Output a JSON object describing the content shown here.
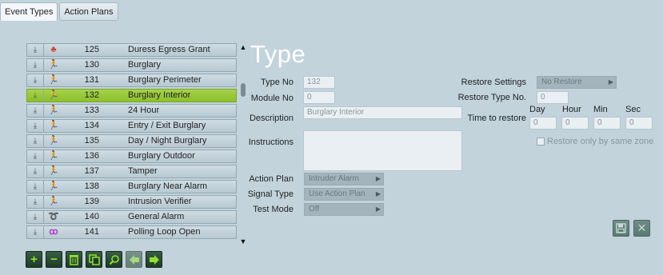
{
  "tabs": [
    {
      "label": "Event Types",
      "active": true
    },
    {
      "label": "Action Plans",
      "active": false
    }
  ],
  "event_list": [
    {
      "num": "125",
      "desc": "Duress Egress Grant",
      "icon": "duress-icon",
      "icon_color": "#d43a2a",
      "selected": false
    },
    {
      "num": "130",
      "desc": "Burglary",
      "icon": "running-man-icon",
      "icon_color": "#e02a1e",
      "selected": false
    },
    {
      "num": "131",
      "desc": "Burglary Perimeter",
      "icon": "running-man-icon",
      "icon_color": "#e02a1e",
      "selected": false
    },
    {
      "num": "132",
      "desc": "Burglary Interior",
      "icon": "running-man-icon",
      "icon_color": "#e02a1e",
      "selected": true
    },
    {
      "num": "133",
      "desc": "24 Hour",
      "icon": "running-man-icon",
      "icon_color": "#e02a1e",
      "selected": false
    },
    {
      "num": "134",
      "desc": "Entry / Exit Burglary",
      "icon": "running-man-icon",
      "icon_color": "#e02a1e",
      "selected": false
    },
    {
      "num": "135",
      "desc": "Day / Night Burglary",
      "icon": "running-man-icon",
      "icon_color": "#e02a1e",
      "selected": false
    },
    {
      "num": "136",
      "desc": "Burglary Outdoor",
      "icon": "running-man-icon",
      "icon_color": "#e02a1e",
      "selected": false
    },
    {
      "num": "137",
      "desc": "Tamper",
      "icon": "running-man-icon",
      "icon_color": "#e02a1e",
      "selected": false
    },
    {
      "num": "138",
      "desc": "Burglary Near Alarm",
      "icon": "running-man-icon",
      "icon_color": "#e02a1e",
      "selected": false
    },
    {
      "num": "139",
      "desc": "Intrusion Verifier",
      "icon": "running-man-icon",
      "icon_color": "#e02a1e",
      "selected": false
    },
    {
      "num": "140",
      "desc": "General Alarm",
      "icon": "alarm-icon",
      "icon_color": "#e0702a",
      "selected": false
    },
    {
      "num": "141",
      "desc": "Polling Loop Open",
      "icon": "polling-loop-icon",
      "icon_color": "#b03ad0",
      "selected": false
    }
  ],
  "form": {
    "title": "Type",
    "type_no_label": "Type No",
    "type_no_value": "132",
    "module_no_label": "Module No",
    "module_no_value": "0",
    "description_label": "Description",
    "description_value": "Burglary Interior",
    "instructions_label": "Instructions",
    "instructions_value": "",
    "action_plan_label": "Action Plan",
    "action_plan_value": "Intruder Alarm",
    "signal_type_label": "Signal Type",
    "signal_type_value": "Use Action Plan",
    "test_mode_label": "Test Mode",
    "test_mode_value": "Off"
  },
  "restore": {
    "settings_label": "Restore Settings",
    "settings_value": "No Restore",
    "type_no_label": "Restore Type No.",
    "type_no_value": "0",
    "time_label": "Time to restore",
    "day_label": "Day",
    "hour_label": "Hour",
    "min_label": "Min",
    "sec_label": "Sec",
    "day_value": "0",
    "hour_value": "0",
    "min_value": "0",
    "sec_value": "0",
    "same_zone_label": "Restore only by same zone",
    "same_zone_checked": false
  },
  "toolbar_icons": [
    "add-icon",
    "remove-icon",
    "delete-icon",
    "copy-icon",
    "search-icon",
    "prev-icon",
    "next-icon"
  ]
}
